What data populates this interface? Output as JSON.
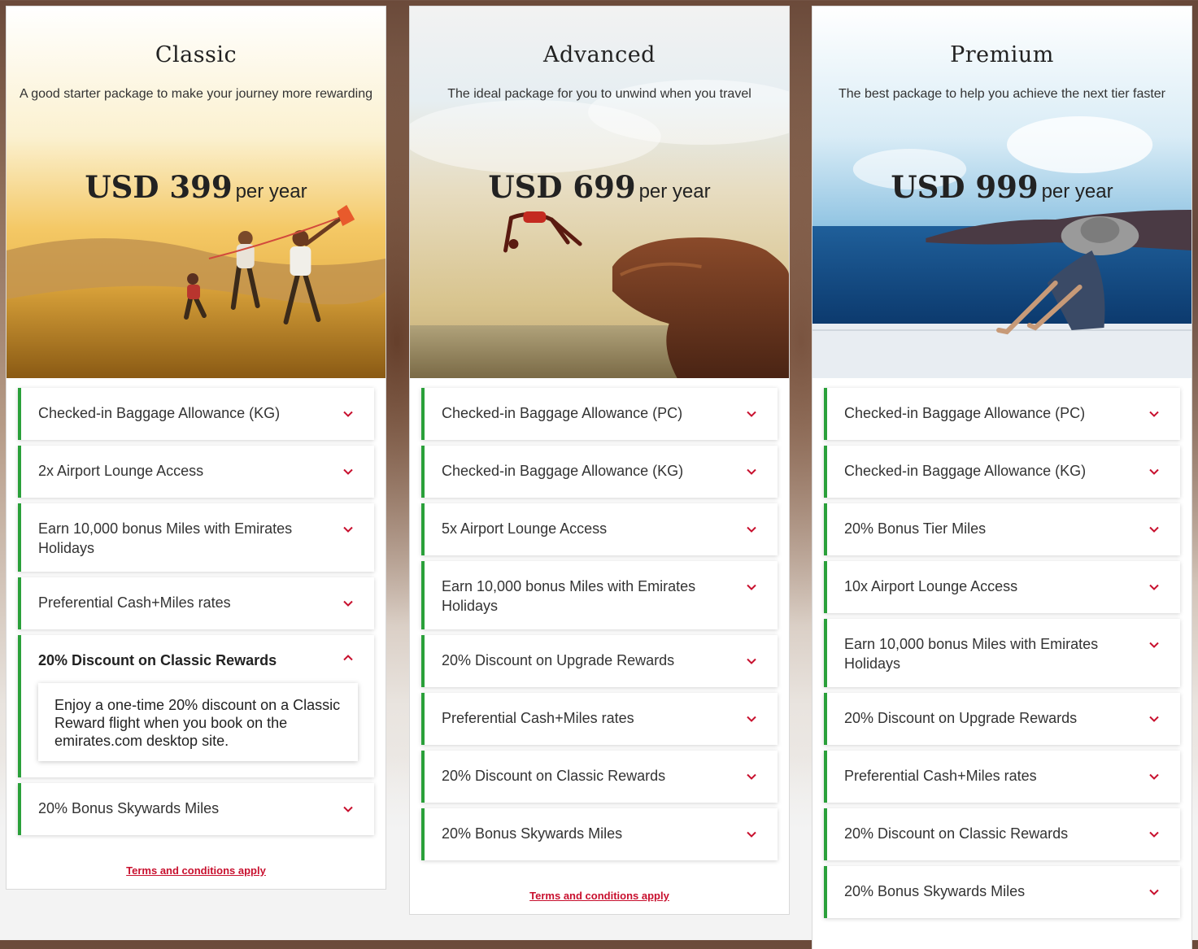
{
  "colors": {
    "accent_green": "#2aa03a",
    "chevron_red": "#c8102e",
    "link_red": "#c8102e"
  },
  "cards": [
    {
      "title": "Classic",
      "subtitle": "A good starter package to make your journey more rewarding",
      "price_amount": "USD 399",
      "price_period": "per year",
      "image": "family-flying-kite-in-golden-field",
      "features": [
        {
          "label": "Checked-in Baggage Allowance (KG)",
          "icon": "chevron-down-icon"
        },
        {
          "label": "2x Airport Lounge Access",
          "icon": "chevron-down-icon"
        },
        {
          "label": "Earn 10,000 bonus Miles with Emirates Holidays",
          "icon": "chevron-down-icon"
        },
        {
          "label": "Preferential Cash+Miles rates",
          "icon": "chevron-down-icon"
        },
        {
          "label": "20% Discount on Classic Rewards",
          "icon": "chevron-up-icon",
          "expanded": true,
          "detail": "Enjoy a one-time 20% discount on a Classic Reward flight when you book on the emirates.com desktop site."
        },
        {
          "label": "20% Bonus Skywards Miles",
          "icon": "chevron-down-icon"
        }
      ],
      "terms": "Terms and conditions apply"
    },
    {
      "title": "Advanced",
      "subtitle": "The ideal package for you to unwind when you travel",
      "price_amount": "USD 699",
      "price_period": "per year",
      "image": "person-backflip-off-cliff-by-sea",
      "features": [
        {
          "label": "Checked-in Baggage Allowance (PC)",
          "icon": "chevron-down-icon"
        },
        {
          "label": "Checked-in Baggage Allowance (KG)",
          "icon": "chevron-down-icon"
        },
        {
          "label": "5x Airport Lounge Access",
          "icon": "chevron-down-icon"
        },
        {
          "label": "Earn 10,000 bonus Miles with Emirates Holidays",
          "icon": "chevron-down-icon"
        },
        {
          "label": "20% Discount on Upgrade Rewards",
          "icon": "chevron-down-icon"
        },
        {
          "label": "Preferential Cash+Miles rates",
          "icon": "chevron-down-icon"
        },
        {
          "label": "20% Discount on Classic Rewards",
          "icon": "chevron-down-icon"
        },
        {
          "label": "20% Bonus Skywards Miles",
          "icon": "chevron-down-icon"
        }
      ],
      "terms": "Terms and conditions apply"
    },
    {
      "title": "Premium",
      "subtitle": "The best package to help you achieve the next tier faster",
      "price_amount": "USD 999",
      "price_period": "per year",
      "image": "woman-in-sunhat-overlooking-blue-sea",
      "features": [
        {
          "label": "Checked-in Baggage Allowance (PC)",
          "icon": "chevron-down-icon"
        },
        {
          "label": "Checked-in Baggage Allowance (KG)",
          "icon": "chevron-down-icon"
        },
        {
          "label": "20% Bonus Tier Miles",
          "icon": "chevron-down-icon"
        },
        {
          "label": "10x Airport Lounge Access",
          "icon": "chevron-down-icon"
        },
        {
          "label": "Earn 10,000 bonus Miles with Emirates Holidays",
          "icon": "chevron-down-icon"
        },
        {
          "label": "20% Discount on Upgrade Rewards",
          "icon": "chevron-down-icon"
        },
        {
          "label": "Preferential Cash+Miles rates",
          "icon": "chevron-down-icon"
        },
        {
          "label": "20% Discount on Classic Rewards",
          "icon": "chevron-down-icon"
        },
        {
          "label": "20% Bonus Skywards Miles",
          "icon": "chevron-down-icon"
        }
      ]
    }
  ]
}
